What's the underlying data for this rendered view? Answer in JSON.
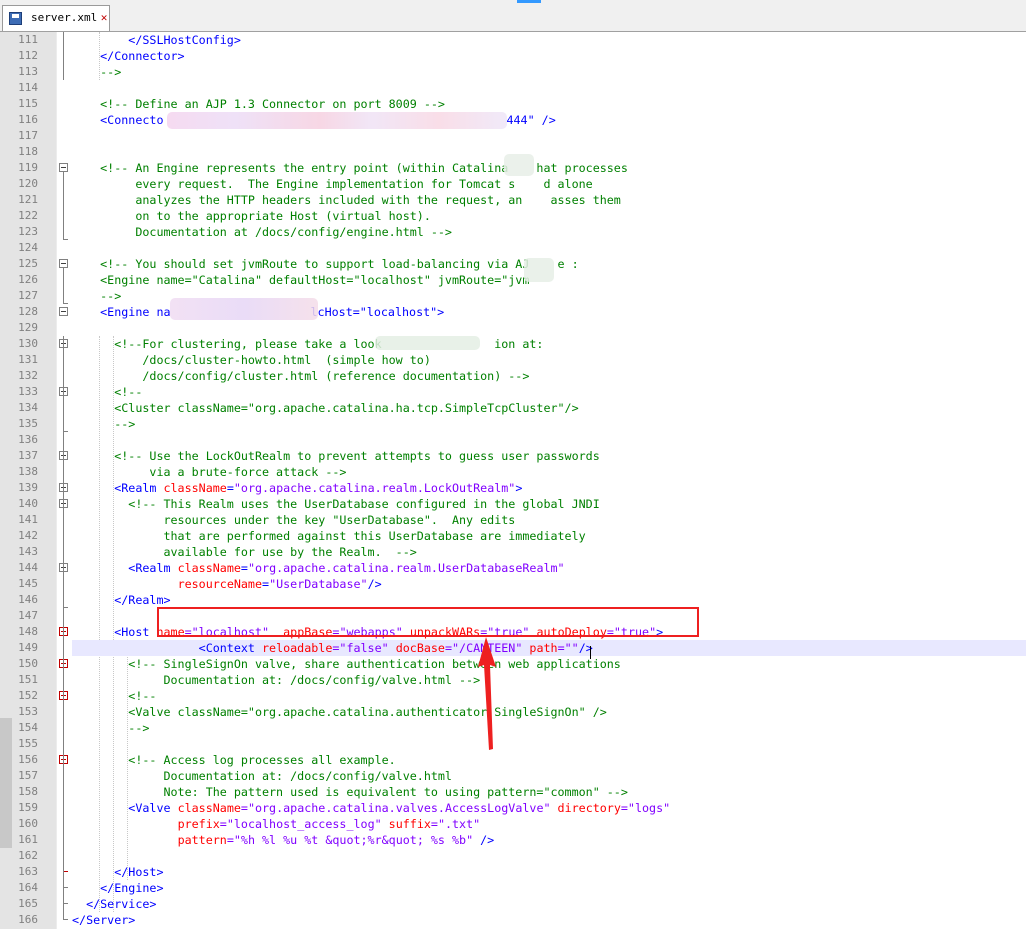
{
  "tab": {
    "label": "server.xml",
    "icon": "save-file-icon",
    "close_icon": "close-icon"
  },
  "colors": {
    "comment": "#008000",
    "tag": "#0000ff",
    "attribute": "#ff0000",
    "value": "#8000ff",
    "annotation": "#ee2020"
  },
  "lines": [
    {
      "n": "111"
    },
    {
      "n": "112"
    },
    {
      "n": "113"
    },
    {
      "n": "114"
    },
    {
      "n": "115"
    },
    {
      "n": "116"
    },
    {
      "n": "117"
    },
    {
      "n": "118"
    },
    {
      "n": "119"
    },
    {
      "n": "120"
    },
    {
      "n": "121"
    },
    {
      "n": "122"
    },
    {
      "n": "123"
    },
    {
      "n": "124"
    },
    {
      "n": "125"
    },
    {
      "n": "126"
    },
    {
      "n": "127"
    },
    {
      "n": "128"
    },
    {
      "n": "129"
    },
    {
      "n": "130"
    },
    {
      "n": "131"
    },
    {
      "n": "132"
    },
    {
      "n": "133"
    },
    {
      "n": "134"
    },
    {
      "n": "135"
    },
    {
      "n": "136"
    },
    {
      "n": "137"
    },
    {
      "n": "138"
    },
    {
      "n": "139"
    },
    {
      "n": "140"
    },
    {
      "n": "141"
    },
    {
      "n": "142"
    },
    {
      "n": "143"
    },
    {
      "n": "144"
    },
    {
      "n": "145"
    },
    {
      "n": "146"
    },
    {
      "n": "147"
    },
    {
      "n": "148"
    },
    {
      "n": "149"
    },
    {
      "n": "150"
    },
    {
      "n": "151"
    },
    {
      "n": "152"
    },
    {
      "n": "153"
    },
    {
      "n": "154"
    },
    {
      "n": "155"
    },
    {
      "n": "156"
    },
    {
      "n": "157"
    },
    {
      "n": "158"
    },
    {
      "n": "159"
    },
    {
      "n": "160"
    },
    {
      "n": "161"
    },
    {
      "n": "162"
    },
    {
      "n": "163"
    },
    {
      "n": "164"
    },
    {
      "n": "165"
    },
    {
      "n": "166"
    }
  ],
  "code": {
    "l111": "        </SSLHostConfig>",
    "l112": "    </Connector>",
    "l113": "    -->",
    "l115": "    <!-- Define an AJP 1.3 Connector on port 8009 -->",
    "l116a": "    <Connecto",
    "l116b": "444\" />",
    "l119": "    <!-- An Engine represents the entry point (within Catalina    hat processes",
    "l120": "         every request.  The Engine implementation for Tomcat s    d alone",
    "l121": "         analyzes the HTTP headers included with the request, an    asses them",
    "l122": "         on to the appropriate Host (virtual host).",
    "l123": "         Documentation at /docs/config/engine.html -->",
    "l125": "    <!-- You should set jvmRoute to support load-balancing via AJ    e :",
    "l126": "    <Engine name=\"Catalina\" defaultHost=\"localhost\" jvmRoute=\"jvm",
    "l127": "    -->",
    "l128a": "    <Engine na",
    "l128b": "lcHost=\"localhost\">",
    "l130": "      <!--For clustering, please take a look                ion at:",
    "l131": "          /docs/cluster-howto.html  (simple how to)",
    "l132": "          /docs/config/cluster.html (reference documentation) -->",
    "l133": "      <!--",
    "l134": "      <Cluster className=\"org.apache.catalina.ha.tcp.SimpleTcpCluster\"/>",
    "l135": "      -->",
    "l137": "      <!-- Use the LockOutRealm to prevent attempts to guess user passwords",
    "l138": "           via a brute-force attack -->",
    "l139_tag": "      <Realm ",
    "l139_attr": "className",
    "l139_eq": "=",
    "l139_val": "\"org.apache.catalina.realm.LockOutRealm\"",
    "l139_end": ">",
    "l140": "        <!-- This Realm uses the UserDatabase configured in the global JNDI",
    "l141": "             resources under the key \"UserDatabase\".  Any edits",
    "l142": "             that are performed against this UserDatabase are immediately",
    "l143": "             available for use by the Realm.  -->",
    "l144_tag": "        <Realm ",
    "l144_attr": "className",
    "l144_eq": "=",
    "l144_val": "\"org.apache.catalina.realm.UserDatabaseRealm\"",
    "l145_pad": "               ",
    "l145_attr": "resourceName",
    "l145_eq": "=",
    "l145_val": "\"UserDatabase\"",
    "l145_end": "/>",
    "l146": "      </Realm>",
    "l148_tag": "      <Host ",
    "l148_a1": "name",
    "l148_v1": "=\"localhost\"",
    "l148_a2": "  appBase",
    "l148_v2": "=\"webapps\"",
    "l148_a3": " unpackWARs",
    "l148_v3": "=\"true\"",
    "l148_a4": " autoDeploy",
    "l148_v4": "=\"true\"",
    "l148_end": ">",
    "l149_tag": "                  <Context ",
    "l149_a1": "reloadable",
    "l149_v1": "=\"false\"",
    "l149_a2": " docBase",
    "l149_v2": "=\"/CANTEEN\"",
    "l149_a3": " path",
    "l149_v3": "=\"\"",
    "l149_end": "/>",
    "l150": "        <!-- SingleSignOn valve, share authentication between web applications",
    "l151": "             Documentation at: /docs/config/valve.html -->",
    "l152": "        <!--",
    "l153": "        <Valve className=\"org.apache.catalina.authenticator.SingleSignOn\" />",
    "l154": "        -->",
    "l156": "        <!-- Access log processes all example.",
    "l157": "             Documentation at: /docs/config/valve.html",
    "l158": "             Note: The pattern used is equivalent to using pattern=\"common\" -->",
    "l159_tag": "        <Valve ",
    "l159_a1": "className",
    "l159_v1": "=\"org.apache.catalina.valves.AccessLogValve\"",
    "l159_a2": " directory",
    "l159_v2": "=\"logs\"",
    "l160_pad": "               ",
    "l160_a1": "prefix",
    "l160_v1": "=\"localhost_access_log\"",
    "l160_a2": " suffix",
    "l160_v2": "=\".txt\"",
    "l161_pad": "               ",
    "l161_a1": "pattern",
    "l161_v1": "=\"%h %l %u %t &quot;%r&quot; %s %b\"",
    "l161_end": " />",
    "l163": "      </Host>",
    "l164": "    </Engine>",
    "l165": "  </Service>",
    "l166": "</Server>"
  }
}
